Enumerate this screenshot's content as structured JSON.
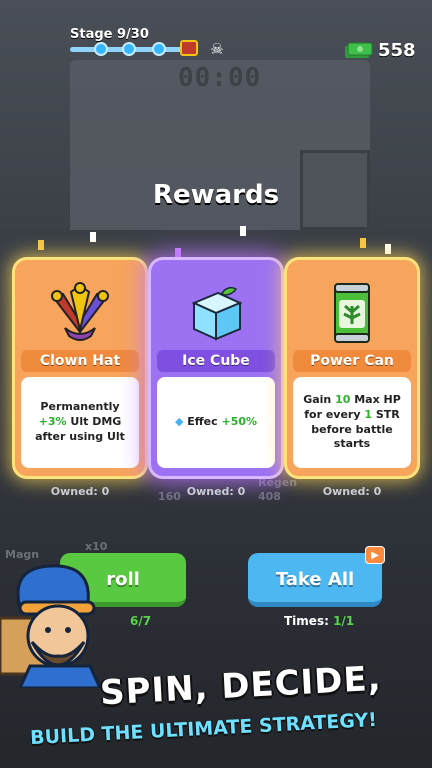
{
  "hud": {
    "stage_label": "Stage 9/30",
    "cash_value": "558",
    "colors": {
      "progress": "#36b6ff",
      "cash": "#3fbf4a"
    }
  },
  "background": {
    "timer": "00:00",
    "magnet_label": "Magn",
    "multiplier": "x10",
    "stat1": "160",
    "stat2": "408",
    "stat3": "Regen"
  },
  "title": "Rewards",
  "cards": [
    {
      "name": "Clown Hat",
      "icon": "jester-hat-icon",
      "rarity_color": "#f08a3c",
      "desc_pre": "Permanently ",
      "desc_value": "+3%",
      "desc_mid": " Ult DMG after using ",
      "desc_post": "Ult",
      "owned": "Owned: 0"
    },
    {
      "name": "Ice Cube",
      "icon": "ice-cube-icon",
      "rarity_color": "#9b6cf0",
      "desc_pre": "Effec ",
      "desc_value": "+50%",
      "owned": "Owned: 0"
    },
    {
      "name": "Power Can",
      "icon": "soda-can-icon",
      "rarity_color": "#f08a3c",
      "desc_pre": "Gain ",
      "desc_value": "10",
      "desc_mid": " Max HP for every ",
      "desc_value2": "1",
      "desc_post": " STR before battle starts",
      "owned": "Owned: 0"
    }
  ],
  "buttons": {
    "roll_label": "roll",
    "roll_count": "6/7",
    "take_all_label": "Take All",
    "times_label": "Times: ",
    "times_value": "1/1"
  },
  "slogan": {
    "line1": "SPIN, DECIDE,",
    "line2": "BUILD THE ULTIMATE STRATEGY!"
  }
}
